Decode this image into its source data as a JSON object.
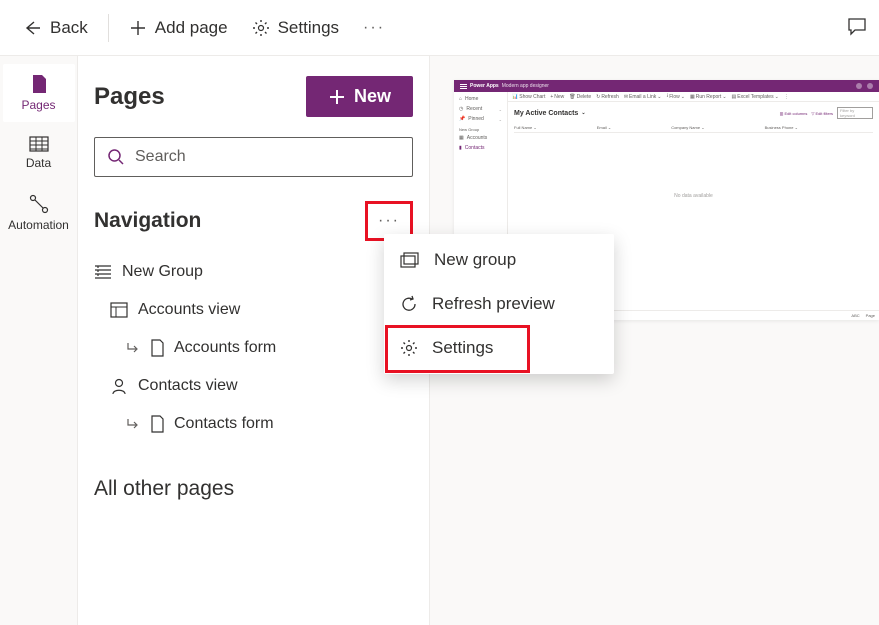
{
  "toolbar": {
    "back": "Back",
    "add_page": "Add page",
    "settings": "Settings"
  },
  "left_rail": {
    "pages": "Pages",
    "data": "Data",
    "automation": "Automation"
  },
  "pages_panel": {
    "title": "Pages",
    "new_button": "New",
    "search_placeholder": "Search",
    "navigation_title": "Navigation",
    "all_other_pages": "All other pages",
    "tree": {
      "group": "New Group",
      "accounts_view": "Accounts view",
      "accounts_form": "Accounts form",
      "contacts_view": "Contacts view",
      "contacts_form": "Contacts form"
    }
  },
  "context_menu": {
    "new_group": "New group",
    "refresh_preview": "Refresh preview",
    "settings": "Settings"
  },
  "preview": {
    "app_name": "Power Apps",
    "app_subtitle": "Modern app designer",
    "sidebar": {
      "home": "Home",
      "recent": "Recent",
      "pinned": "Pinned",
      "group_label": "New Group",
      "accounts": "Accounts",
      "contacts": "Contacts"
    },
    "commandbar": {
      "show_chart": "Show Chart",
      "new": "New",
      "delete": "Delete",
      "refresh": "Refresh",
      "email_link": "Email a Link",
      "flow": "Flow",
      "run_report": "Run Report",
      "excel_templates": "Excel Templates"
    },
    "heading": "My Active Contacts",
    "actions": {
      "edit_columns": "Edit columns",
      "edit_filters": "Edit filters",
      "filter_placeholder": "Filter by keyword"
    },
    "columns": {
      "full_name": "Full Name",
      "email": "Email",
      "company": "Company Name",
      "business_phone": "Business Phone"
    },
    "no_data": "No data available",
    "footer": {
      "abc": "ABC",
      "page": "Page"
    }
  }
}
